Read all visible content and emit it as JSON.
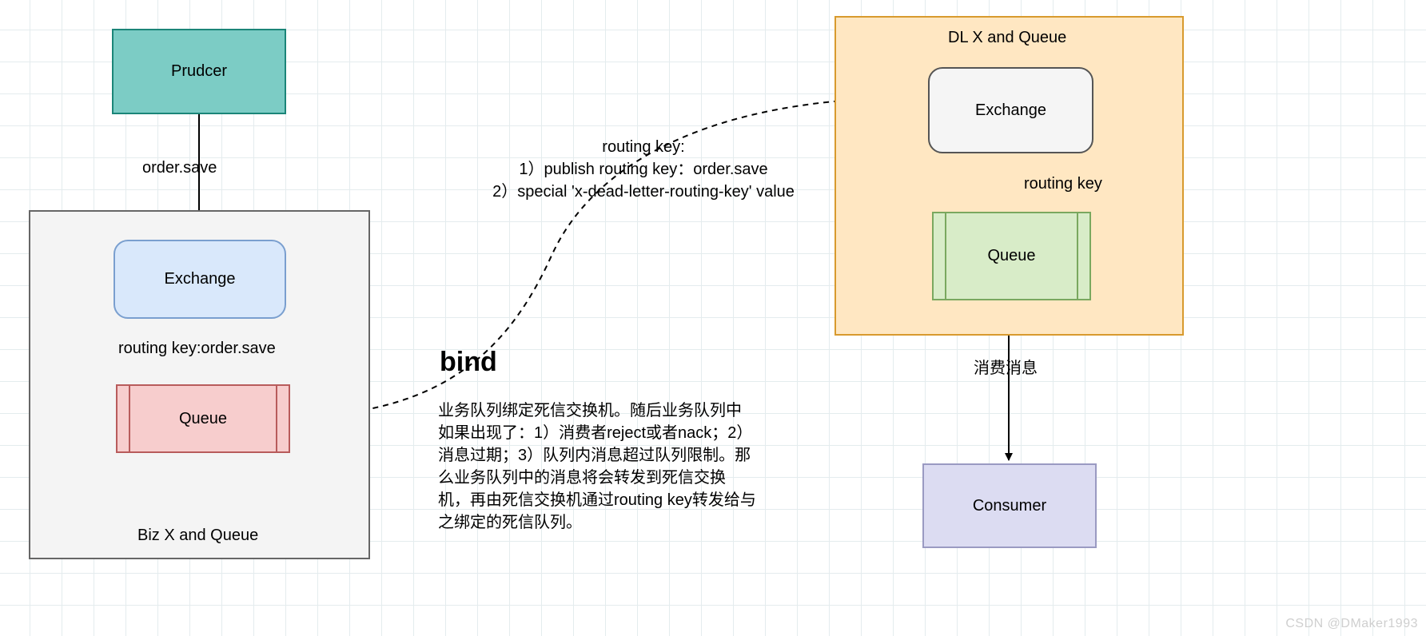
{
  "producer": {
    "label": "Prudcer"
  },
  "producer_to_biz_exchange_label": "order.save",
  "biz": {
    "container_label": "Biz X and Queue",
    "exchange_label": "Exchange",
    "routing_label": "routing key:order.save",
    "queue_label": "Queue"
  },
  "dl": {
    "container_label": "DL X and Queue",
    "exchange_label": "Exchange",
    "routing_label": "routing key",
    "queue_label": "Queue"
  },
  "consumer": {
    "label": "Consumer"
  },
  "consume_label": "消费消息",
  "bind_heading": "bind",
  "routing_key_note": "routing key:\n1）publish routing key：order.save\n2）special 'x-dead-letter-routing-key' value",
  "bind_description": "业务队列绑定死信交换机。随后业务队列中如果出现了：1）消费者reject或者nack；2）消息过期；3）队列内消息超过队列限制。那么业务队列中的消息将会转发到死信交换机，再由死信交换机通过routing key转发给与之绑定的死信队列。",
  "watermark": "CSDN @DMaker1993",
  "colors": {
    "producer_fill": "#7cccc5",
    "biz_container_fill": "#f4f4f4",
    "biz_exchange_fill": "#d9e8fb",
    "biz_queue_fill": "#f7cdcd",
    "dl_container_fill": "#ffe7c2",
    "dl_exchange_fill": "#f5f5f5",
    "dl_queue_fill": "#d8ecc8",
    "consumer_fill": "#dcdcf2"
  }
}
